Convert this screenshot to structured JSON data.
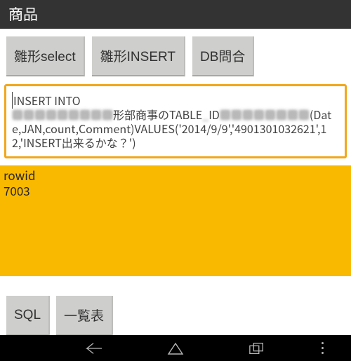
{
  "titlebar": {
    "title": "商品"
  },
  "toolbar": {
    "btn_select": "雛形select",
    "btn_insert": "雛形INSERT",
    "btn_db": "DB問合"
  },
  "sql_input": {
    "line1_a": "INSERT INTO",
    "line2_blur_a": "■■■■■■■■■",
    "line2_mid": "形部商事のTABLE",
    "line2_blur_mid": "_",
    "line2_mid2": "ID",
    "line2_blur_b": "■■■■■■■■",
    "line2_tail": "(Date,JAN,count,Comment)VALUES('2014/9/9','4901301032621',12,'INSERT出来るかな？')"
  },
  "result": {
    "row1": "rowid",
    "row2": "7003"
  },
  "bottom": {
    "btn_sql": "SQL",
    "btn_list": "一覧表"
  }
}
